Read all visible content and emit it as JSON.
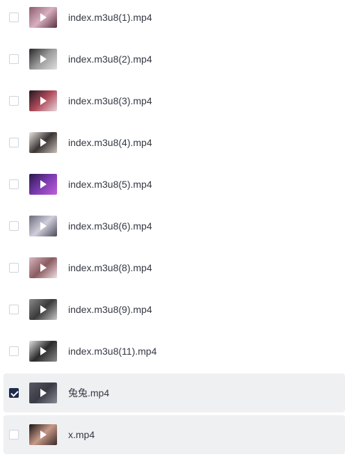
{
  "files": [
    {
      "name": "index.m3u8(1).mp4",
      "checked": false,
      "highlighted": false,
      "thumb_colors": [
        "#8a5c6e",
        "#d8b0c0",
        "#5a3040"
      ]
    },
    {
      "name": "index.m3u8(2).mp4",
      "checked": false,
      "highlighted": false,
      "thumb_colors": [
        "#2a2628",
        "#9a9a9a",
        "#e0e0e0"
      ]
    },
    {
      "name": "index.m3u8(3).mp4",
      "checked": false,
      "highlighted": false,
      "thumb_colors": [
        "#1e1820",
        "#b04a5a",
        "#e8d8dc"
      ]
    },
    {
      "name": "index.m3u8(4).mp4",
      "checked": false,
      "highlighted": false,
      "thumb_colors": [
        "#e8e4e0",
        "#3a3434",
        "#c8c0b8"
      ]
    },
    {
      "name": "index.m3u8(5).mp4",
      "checked": false,
      "highlighted": false,
      "thumb_colors": [
        "#2a1a4a",
        "#7a3ab0",
        "#c060d8"
      ]
    },
    {
      "name": "index.m3u8(6).mp4",
      "checked": false,
      "highlighted": false,
      "thumb_colors": [
        "#6a6a7a",
        "#d0d0dc",
        "#4a4a5a"
      ]
    },
    {
      "name": "index.m3u8(8).mp4",
      "checked": false,
      "highlighted": false,
      "thumb_colors": [
        "#d8b8c0",
        "#8a5a60",
        "#f0e0e4"
      ]
    },
    {
      "name": "index.m3u8(9).mp4",
      "checked": false,
      "highlighted": false,
      "thumb_colors": [
        "#8a8a8a",
        "#3a3a3a",
        "#c8c8c8"
      ]
    },
    {
      "name": "index.m3u8(11).mp4",
      "checked": false,
      "highlighted": false,
      "thumb_colors": [
        "#e0e0e0",
        "#2a2a2a",
        "#8a8a8a"
      ]
    },
    {
      "name": "兔兔.mp4",
      "checked": true,
      "highlighted": true,
      "thumb_colors": [
        "#5a5a66",
        "#3a3a44",
        "#8a8a96"
      ]
    },
    {
      "name": "x.mp4",
      "checked": false,
      "highlighted": true,
      "thumb_colors": [
        "#1a1414",
        "#c89a88",
        "#3a2a2a"
      ]
    }
  ]
}
